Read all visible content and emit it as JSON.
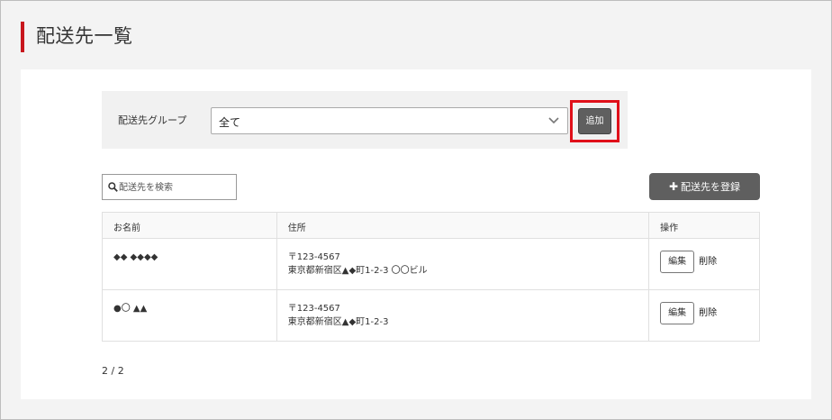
{
  "page": {
    "title": "配送先一覧"
  },
  "group_filter": {
    "label": "配送先グループ",
    "selected": "全て",
    "add_label": "追加"
  },
  "search": {
    "placeholder": "配送先を検索"
  },
  "register_label": "配送先を登録",
  "table": {
    "headers": [
      "お名前",
      "住所",
      "操作"
    ],
    "rows": [
      {
        "name": "◆◆ ◆◆◆◆",
        "postal": "〒123-4567",
        "address": "東京都新宿区▲◆町1-2-3 〇〇ビル",
        "edit_label": "編集",
        "delete_label": "削除"
      },
      {
        "name": "●〇 ▲▲",
        "postal": "〒123-4567",
        "address": "東京都新宿区▲◆町1-2-3",
        "edit_label": "編集",
        "delete_label": "削除"
      }
    ]
  },
  "pager": "2 / 2",
  "colors": {
    "accent": "#c8161d",
    "highlight": "#e0101a",
    "button_bg": "#5f5f5f",
    "panel_bg": "#ffffff",
    "page_bg": "#f3f3f3"
  },
  "icons": {
    "search": "search-icon",
    "dropdown": "chevron-down-icon",
    "register": "plus-icon"
  }
}
